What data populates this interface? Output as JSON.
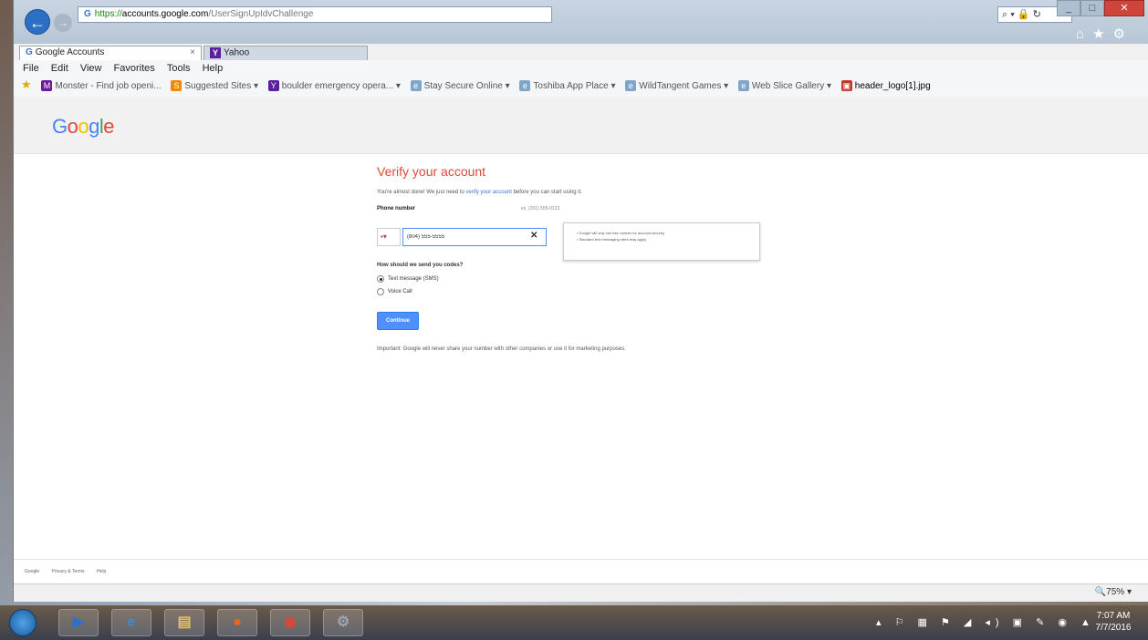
{
  "browser": {
    "url_scheme": "https://",
    "url_host": "accounts.google.com",
    "url_path": "/UserSignUpIdvChallenge",
    "search_icons": "⌕ ▾ 🔒 ↻",
    "toolbar_icons": "⌂★⚙"
  },
  "tabs": [
    {
      "label": "Google Accounts",
      "icon": "G"
    },
    {
      "label": "Yahoo",
      "icon": "Y"
    }
  ],
  "menu": [
    "File",
    "Edit",
    "View",
    "Favorites",
    "Tools",
    "Help"
  ],
  "favorites": [
    {
      "label": "Monster - Find job openi...",
      "icon": "M",
      "color": "#6a1b9a"
    },
    {
      "label": "Suggested Sites ▾",
      "icon": "S",
      "color": "#f08a00"
    },
    {
      "label": "boulder emergency opera... ▾",
      "icon": "Y",
      "color": "#5c1f9e"
    },
    {
      "label": "Stay Secure Online ▾",
      "icon": "e",
      "color": "#7fa6c9"
    },
    {
      "label": "Toshiba App Place ▾",
      "icon": "e",
      "color": "#7fa6c9"
    },
    {
      "label": "WildTangent Games ▾",
      "icon": "e",
      "color": "#7fa6c9"
    },
    {
      "label": "Web Slice Gallery ▾",
      "icon": "e",
      "color": "#7fa6c9"
    },
    {
      "label": "header_logo[1].jpg",
      "icon": "▣",
      "color": "#c0392b"
    }
  ],
  "page": {
    "logo": {
      "g1": "G",
      "o1": "o",
      "o2": "o",
      "g2": "g",
      "l": "l",
      "e": "e"
    },
    "title": "Verify your account",
    "intro_before": "You're almost done! We just need to ",
    "intro_link": "verify your account",
    "intro_after": " before you can start using it.",
    "phone_label": "Phone number",
    "phone_example": "ex. (201) 555-0123",
    "flag": "▪▾",
    "phone_value": "(804) 555-5555",
    "clear_glyph": "✕",
    "tooltip_lines": [
      "Google will only use this number for account security.",
      "Standard text messaging rates may apply."
    ],
    "method_label": "How should we send you codes?",
    "methods": [
      {
        "label": "Text message (SMS)",
        "selected": true
      },
      {
        "label": "Voice Call",
        "selected": false
      }
    ],
    "continue_label": "Continue",
    "important": "Important: Google will never share your number with other companies or use it for marketing purposes."
  },
  "footer": [
    "Google",
    "Privacy & Terms",
    "Help"
  ],
  "status": {
    "zoom": "🔍75%  ▾"
  },
  "taskbar": {
    "apps": [
      {
        "name": "media",
        "glyph": "▶",
        "color": "#2a72c9"
      },
      {
        "name": "ie",
        "glyph": "e",
        "color": "#3b8ad9"
      },
      {
        "name": "explorer",
        "glyph": "▤",
        "color": "#e8c15a"
      },
      {
        "name": "firefox",
        "glyph": "●",
        "color": "#e8661f"
      },
      {
        "name": "chrome",
        "glyph": "◉",
        "color": "#d9473a"
      },
      {
        "name": "settings",
        "glyph": "⚙",
        "color": "#9aa4b0"
      }
    ],
    "tray": "▴ ⚐ ▦ ⚑ ◢ ◂) ▣ ✎ ◉ ▲",
    "time": "7:07 AM",
    "date": "7/7/2016"
  }
}
